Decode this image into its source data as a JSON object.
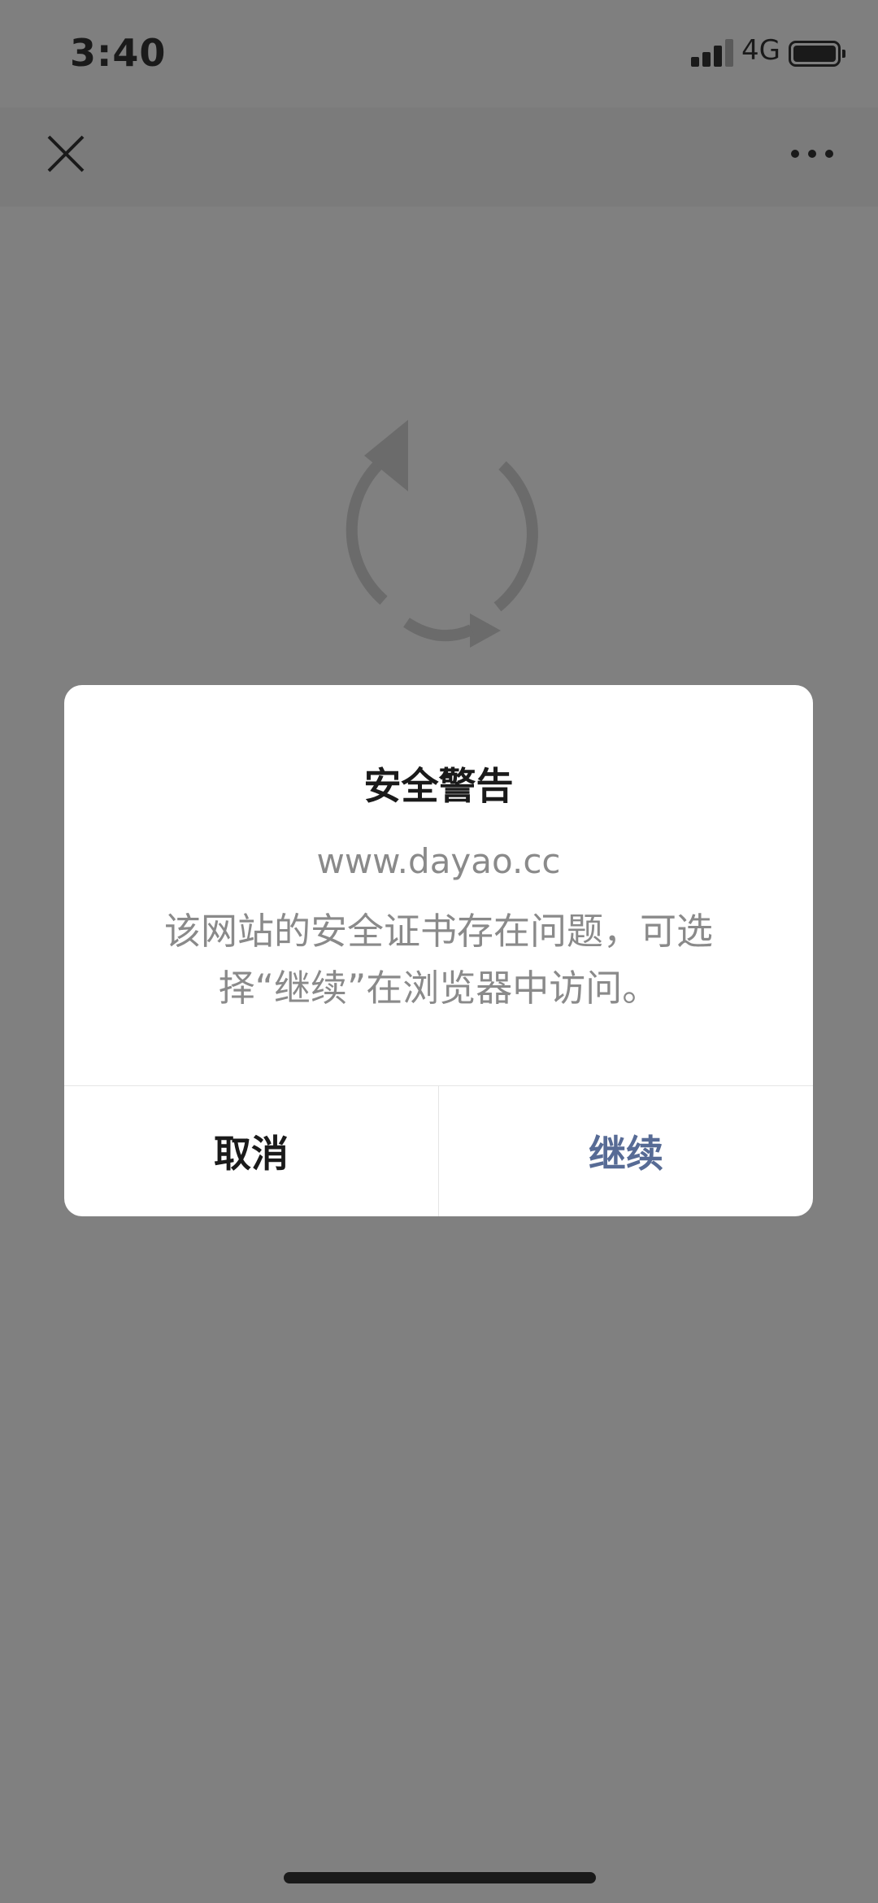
{
  "status_bar": {
    "time": "3:40",
    "network": "4G",
    "signal_bars": 3,
    "battery_level": 0.9
  },
  "nav": {
    "close_icon": "close-icon",
    "more_icon": "more-horizontal-icon"
  },
  "loading": {
    "icon": "refresh-icon"
  },
  "dialog": {
    "title": "安全警告",
    "url": "www.dayao.cc",
    "message": "该网站的安全证书存在问题，可选择“继续”在浏览器中访问。",
    "cancel_label": "取消",
    "continue_label": "继续"
  },
  "colors": {
    "overlay": "#808080",
    "dialog_bg": "#ffffff",
    "primary_text": "#1a1a1a",
    "secondary_text": "#8a8a8a",
    "link_blue": "#576b95"
  }
}
